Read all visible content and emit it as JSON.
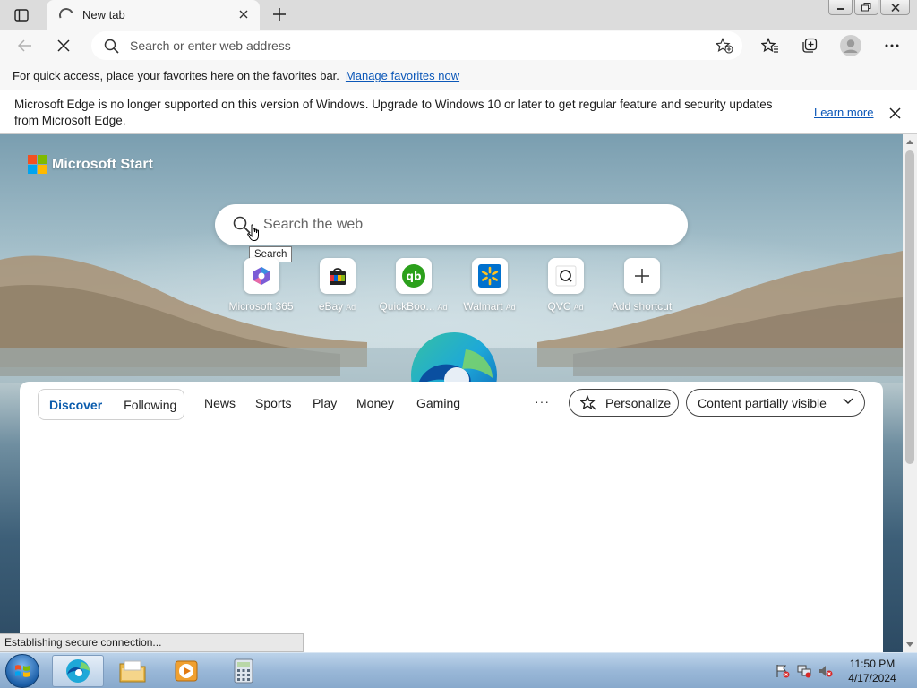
{
  "tab": {
    "title": "New tab"
  },
  "address": {
    "placeholder": "Search or enter web address"
  },
  "favorites_bar": {
    "message": "For quick access, place your favorites here on the favorites bar.",
    "link": "Manage favorites now"
  },
  "infobar": {
    "message": "Microsoft Edge is no longer supported on this version of Windows. Upgrade to Windows 10 or later to get regular feature and security updates from Microsoft Edge.",
    "learn_more": "Learn more"
  },
  "start": {
    "brand": "Microsoft Start",
    "search_placeholder": "Search the web",
    "tooltip": "Search",
    "shortcuts": [
      {
        "label": "Microsoft 365",
        "ad": "",
        "icon": "microsoft-365-icon"
      },
      {
        "label": "eBay",
        "ad": "Ad",
        "icon": "ebay-icon"
      },
      {
        "label": "QuickBoo...",
        "ad": "Ad",
        "icon": "quickbooks-icon"
      },
      {
        "label": "Walmart",
        "ad": "Ad",
        "icon": "walmart-icon"
      },
      {
        "label": "QVC",
        "ad": "Ad",
        "icon": "qvc-icon"
      },
      {
        "label": "Add shortcut",
        "ad": "",
        "icon": "plus-icon"
      }
    ]
  },
  "feed": {
    "tabs": {
      "discover": "Discover",
      "following": "Following"
    },
    "nav": [
      "News",
      "Sports",
      "Play",
      "Money",
      "Gaming"
    ],
    "more": "···",
    "personalize": "Personalize",
    "content_visibility": "Content partially visible"
  },
  "status": "Establishing secure connection...",
  "clock": {
    "time": "11:50 PM",
    "date": "4/17/2024"
  },
  "colors": {
    "accent": "#0b57b8",
    "ms_red": "#f25022",
    "ms_green": "#7fba00",
    "ms_blue": "#00a4ef",
    "ms_yellow": "#ffb900"
  }
}
